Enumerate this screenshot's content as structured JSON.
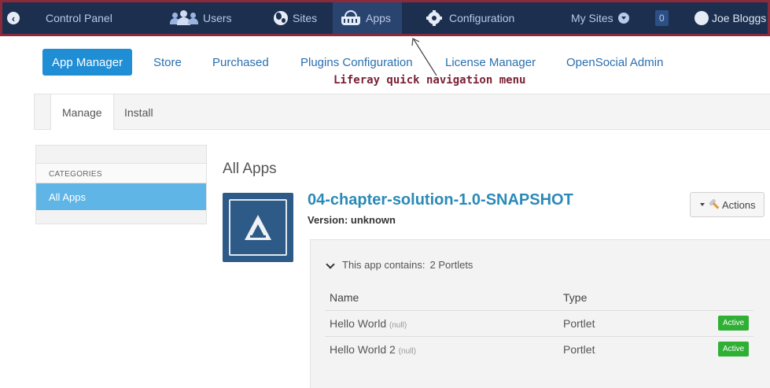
{
  "dock": {
    "title": "Control Panel",
    "users": "Users",
    "sites": "Sites",
    "apps": "Apps",
    "configuration": "Configuration",
    "my_sites": "My Sites",
    "count": "0",
    "user_name": "Joe Bloggs",
    "border_color": "#8b2a3a",
    "bg_color": "#1c2f4f"
  },
  "subnav": {
    "tabs": [
      "App Manager",
      "Store",
      "Purchased",
      "Plugins Configuration",
      "License Manager",
      "OpenSocial Admin"
    ]
  },
  "annotation": "Liferay quick navigation menu",
  "actionbar": {
    "manage": "Manage",
    "install": "Install"
  },
  "sidebar": {
    "heading": "CATEGORIES",
    "items": [
      "All Apps"
    ]
  },
  "main": {
    "title": "All Apps",
    "app_name": "04-chapter-solution-1.0-SNAPSHOT",
    "version": "Version: unknown",
    "actions_label": "Actions",
    "contains": "This app contains:",
    "contains_count": "2 Portlets",
    "columns": {
      "name": "Name",
      "type": "Type"
    },
    "rows": [
      {
        "name": "Hello World",
        "note": "(null)",
        "type": "Portlet",
        "status": "Active"
      },
      {
        "name": "Hello World 2",
        "note": "(null)",
        "type": "Portlet",
        "status": "Active"
      }
    ]
  },
  "colors": {
    "accent": "#1f8ed5",
    "selected_category": "#5fb5e6",
    "active_badge": "#2fb035",
    "annotation": "#7a1f33"
  }
}
